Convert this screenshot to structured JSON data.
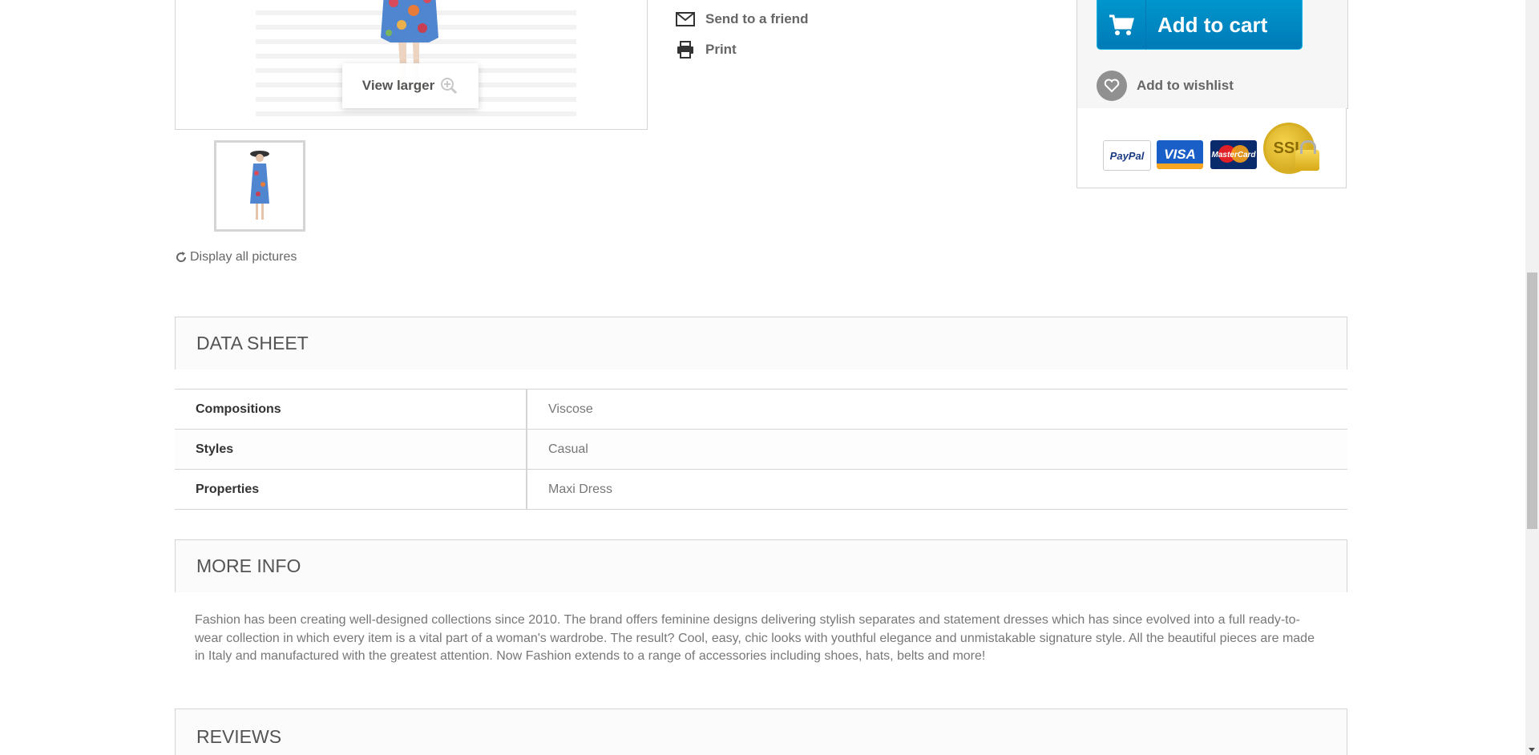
{
  "product_image": {
    "view_larger_label": "View larger",
    "display_all_label": "Display all pictures"
  },
  "actions": {
    "send_to_friend_label": "Send to a friend",
    "print_label": "Print"
  },
  "buy_box": {
    "add_to_cart_label": "Add to cart",
    "add_to_wishlist_label": "Add to wishlist",
    "accent_color": "#009ad0",
    "payment_logos": [
      "PayPal",
      "VISA",
      "MasterCard",
      "SSL"
    ]
  },
  "data_sheet": {
    "title": "DATA SHEET",
    "rows": [
      {
        "key": "Compositions",
        "value": "Viscose"
      },
      {
        "key": "Styles",
        "value": "Casual"
      },
      {
        "key": "Properties",
        "value": "Maxi Dress"
      }
    ]
  },
  "more_info": {
    "title": "MORE INFO",
    "text": "Fashion has been creating well-designed collections since 2010. The brand offers feminine designs delivering stylish separates and statement dresses which has since evolved into a full ready-to-wear collection in which every item is a vital part of a woman's wardrobe. The result? Cool, easy, chic looks with youthful elegance and unmistakable signature style. All the beautiful pieces are made in Italy and manufactured with the greatest attention. Now Fashion extends to a range of accessories including shoes, hats, belts and more!"
  },
  "reviews": {
    "title": "REVIEWS"
  }
}
